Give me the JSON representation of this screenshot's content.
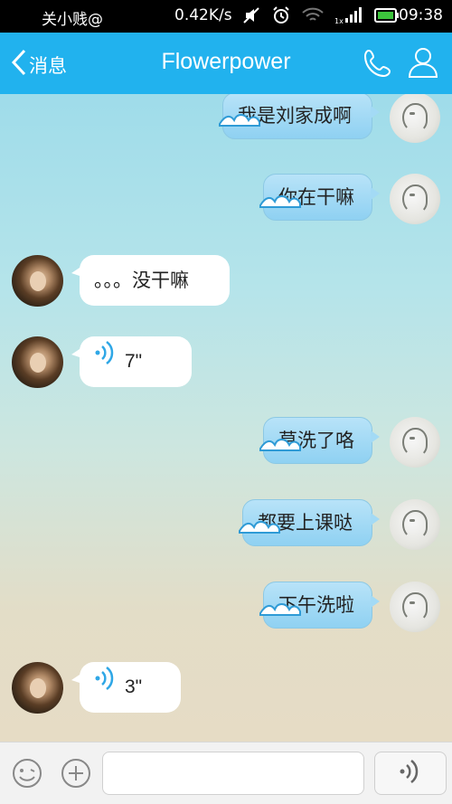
{
  "status_bar": {
    "carrier": "关小贱@",
    "speed": "0.42K/s",
    "time": "09:38",
    "icons": [
      "mute-icon",
      "alarm-icon",
      "wifi-icon",
      "signal-icon",
      "battery-icon"
    ]
  },
  "header": {
    "back_label": "消息",
    "title": "Flowerpower",
    "actions": [
      "phone-icon",
      "profile-icon"
    ]
  },
  "messages": [
    {
      "from": "me",
      "type": "text",
      "text": "我是刘家成啊"
    },
    {
      "from": "me",
      "type": "text",
      "text": "你在干嘛"
    },
    {
      "from": "her",
      "type": "text",
      "text": "。。。没干嘛"
    },
    {
      "from": "her",
      "type": "voice",
      "duration": "7\""
    },
    {
      "from": "me",
      "type": "text",
      "text": "莫洗了咯"
    },
    {
      "from": "me",
      "type": "text",
      "text": "都要上课哒"
    },
    {
      "from": "me",
      "type": "text",
      "text": "下午洗啦"
    },
    {
      "from": "her",
      "type": "voice",
      "duration": "3\""
    }
  ],
  "input_bar": {
    "placeholder": "",
    "value": "",
    "buttons": [
      "emoji-icon",
      "plus-icon",
      "voice-icon"
    ]
  },
  "colors": {
    "header_bg": "#21b2ee",
    "my_bubble": "#a3daf5",
    "her_bubble": "#ffffff"
  }
}
